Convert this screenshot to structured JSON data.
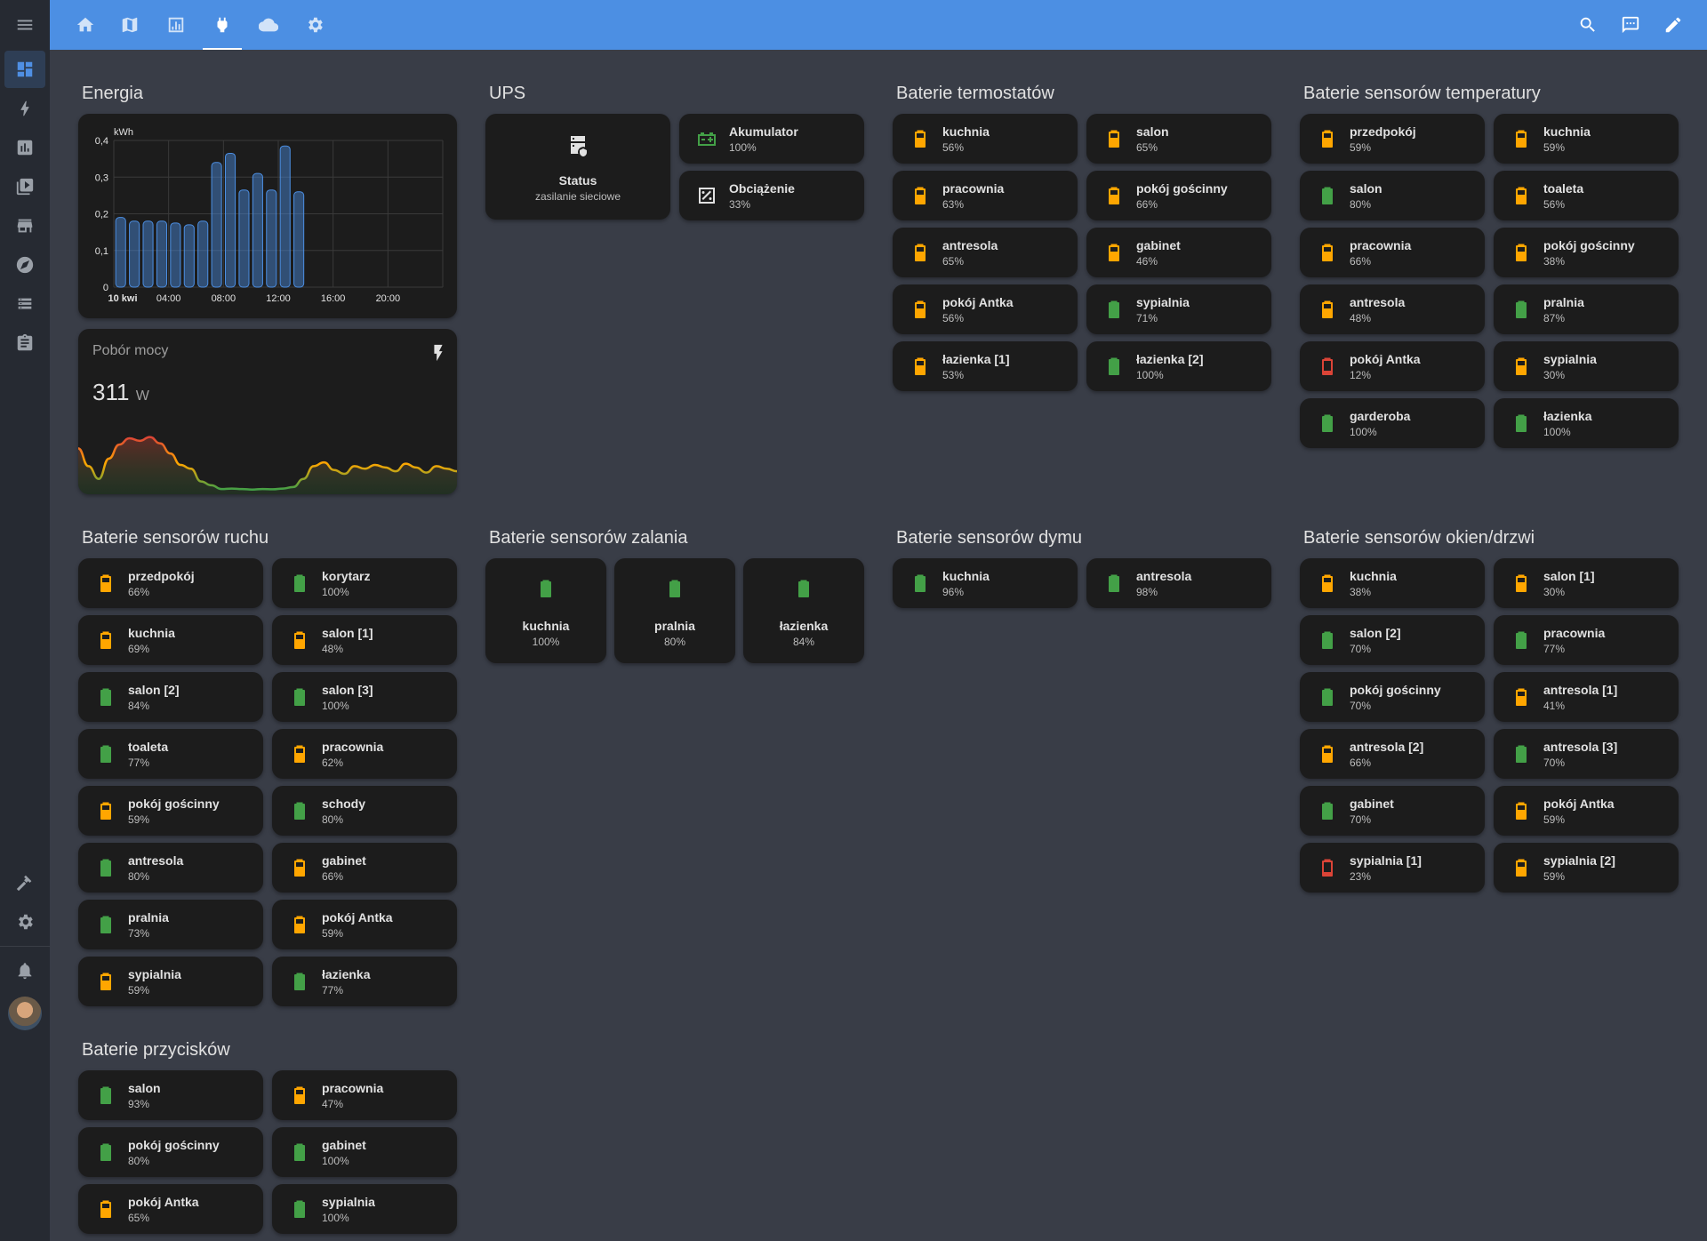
{
  "colors": {
    "header": "#4c8fe3",
    "green": "#43a047",
    "orange": "#ffa600",
    "red": "#db4437"
  },
  "header": {
    "tabs": [
      "home-icon",
      "map-icon",
      "chart-icon",
      "plug-icon",
      "cloud-icon",
      "gear-icon"
    ],
    "active_tab": "plug-icon",
    "actions": [
      "search-icon",
      "assist-icon",
      "pencil-icon"
    ]
  },
  "sidebar": {
    "items": [
      "menu-icon",
      "dashboard-icon",
      "energy-icon",
      "history-icon",
      "media-icon",
      "store-icon",
      "compass-icon",
      "devices-icon",
      "clipboard-icon"
    ],
    "bottom": [
      "hammer-icon",
      "settings-icon",
      "bell-icon",
      "avatar"
    ]
  },
  "energy": {
    "title": "Energia",
    "chart_data": {
      "type": "bar",
      "ylabel": "kWh",
      "ylim": [
        0,
        0.4
      ],
      "yticks": [
        "0",
        "0,1",
        "0,2",
        "0,3",
        "0,4"
      ],
      "xticks": [
        "10 kwi",
        "04:00",
        "08:00",
        "12:00",
        "16:00",
        "20:00"
      ],
      "categories": [
        "00:00",
        "01:00",
        "02:00",
        "03:00",
        "04:00",
        "05:00",
        "06:00",
        "07:00",
        "08:00",
        "09:00",
        "10:00",
        "11:00",
        "12:00",
        "13:00"
      ],
      "values": [
        0.19,
        0.18,
        0.18,
        0.18,
        0.175,
        0.17,
        0.18,
        0.34,
        0.365,
        0.265,
        0.31,
        0.265,
        0.385,
        0.26
      ]
    }
  },
  "power": {
    "title": "Pobór mocy",
    "value": "311",
    "unit": "W",
    "icon": "flash-icon",
    "chart_data": {
      "type": "line",
      "values": [
        110,
        180,
        230,
        150,
        95,
        70,
        80,
        65,
        90,
        130,
        175,
        190,
        240,
        255,
        270,
        268,
        270,
        272,
        270,
        271,
        268,
        262,
        230,
        180,
        165,
        195,
        210,
        180,
        190,
        175,
        185,
        200,
        170,
        185,
        205,
        180,
        190,
        200
      ]
    }
  },
  "ups": {
    "title": "UPS",
    "status": {
      "name": "Status",
      "value": "zasilanie sieciowe",
      "icon": "server-icon"
    },
    "items": [
      {
        "name": "Akumulator",
        "value": "100%",
        "icon": "battery-charging-icon"
      },
      {
        "name": "Obciążenie",
        "value": "33%",
        "icon": "percent-box-icon"
      }
    ]
  },
  "thermostats": {
    "title": "Baterie termostatów",
    "items": [
      {
        "name": "kuchnia",
        "value": "56%",
        "level": "orange"
      },
      {
        "name": "salon",
        "value": "65%",
        "level": "orange"
      },
      {
        "name": "pracownia",
        "value": "63%",
        "level": "orange"
      },
      {
        "name": "pokój gościnny",
        "value": "66%",
        "level": "orange"
      },
      {
        "name": "antresola",
        "value": "65%",
        "level": "orange"
      },
      {
        "name": "gabinet",
        "value": "46%",
        "level": "orange"
      },
      {
        "name": "pokój Antka",
        "value": "56%",
        "level": "orange"
      },
      {
        "name": "sypialnia",
        "value": "71%",
        "level": "green"
      },
      {
        "name": "łazienka [1]",
        "value": "53%",
        "level": "orange"
      },
      {
        "name": "łazienka [2]",
        "value": "100%",
        "level": "green"
      }
    ]
  },
  "temperature": {
    "title": "Baterie sensorów temperatury",
    "items": [
      {
        "name": "przedpokój",
        "value": "59%",
        "level": "orange"
      },
      {
        "name": "kuchnia",
        "value": "59%",
        "level": "orange"
      },
      {
        "name": "salon",
        "value": "80%",
        "level": "green"
      },
      {
        "name": "toaleta",
        "value": "56%",
        "level": "orange"
      },
      {
        "name": "pracownia",
        "value": "66%",
        "level": "orange"
      },
      {
        "name": "pokój gościnny",
        "value": "38%",
        "level": "orange"
      },
      {
        "name": "antresola",
        "value": "48%",
        "level": "orange"
      },
      {
        "name": "pralnia",
        "value": "87%",
        "level": "green"
      },
      {
        "name": "pokój Antka",
        "value": "12%",
        "level": "red"
      },
      {
        "name": "sypialnia",
        "value": "30%",
        "level": "orange"
      },
      {
        "name": "garderoba",
        "value": "100%",
        "level": "green"
      },
      {
        "name": "łazienka",
        "value": "100%",
        "level": "green"
      }
    ]
  },
  "motion": {
    "title": "Baterie sensorów ruchu",
    "items": [
      {
        "name": "przedpokój",
        "value": "66%",
        "level": "orange"
      },
      {
        "name": "korytarz",
        "value": "100%",
        "level": "green"
      },
      {
        "name": "kuchnia",
        "value": "69%",
        "level": "orange"
      },
      {
        "name": "salon [1]",
        "value": "48%",
        "level": "orange"
      },
      {
        "name": "salon [2]",
        "value": "84%",
        "level": "green"
      },
      {
        "name": "salon [3]",
        "value": "100%",
        "level": "green"
      },
      {
        "name": "toaleta",
        "value": "77%",
        "level": "green"
      },
      {
        "name": "pracownia",
        "value": "62%",
        "level": "orange"
      },
      {
        "name": "pokój gościnny",
        "value": "59%",
        "level": "orange"
      },
      {
        "name": "schody",
        "value": "80%",
        "level": "green"
      },
      {
        "name": "antresola",
        "value": "80%",
        "level": "green"
      },
      {
        "name": "gabinet",
        "value": "66%",
        "level": "orange"
      },
      {
        "name": "pralnia",
        "value": "73%",
        "level": "green"
      },
      {
        "name": "pokój Antka",
        "value": "59%",
        "level": "orange"
      },
      {
        "name": "sypialnia",
        "value": "59%",
        "level": "orange"
      },
      {
        "name": "łazienka",
        "value": "77%",
        "level": "green"
      }
    ]
  },
  "flood": {
    "title": "Baterie sensorów zalania",
    "items": [
      {
        "name": "kuchnia",
        "value": "100%",
        "level": "green"
      },
      {
        "name": "pralnia",
        "value": "80%",
        "level": "green"
      },
      {
        "name": "łazienka",
        "value": "84%",
        "level": "green"
      }
    ]
  },
  "smoke": {
    "title": "Baterie sensorów dymu",
    "items": [
      {
        "name": "kuchnia",
        "value": "96%",
        "level": "green"
      },
      {
        "name": "antresola",
        "value": "98%",
        "level": "green"
      }
    ]
  },
  "windows": {
    "title": "Baterie sensorów okien/drzwi",
    "items": [
      {
        "name": "kuchnia",
        "value": "38%",
        "level": "orange"
      },
      {
        "name": "salon [1]",
        "value": "30%",
        "level": "orange"
      },
      {
        "name": "salon [2]",
        "value": "70%",
        "level": "green"
      },
      {
        "name": "pracownia",
        "value": "77%",
        "level": "green"
      },
      {
        "name": "pokój gościnny",
        "value": "70%",
        "level": "green"
      },
      {
        "name": "antresola [1]",
        "value": "41%",
        "level": "orange"
      },
      {
        "name": "antresola [2]",
        "value": "66%",
        "level": "orange"
      },
      {
        "name": "antresola [3]",
        "value": "70%",
        "level": "green"
      },
      {
        "name": "gabinet",
        "value": "70%",
        "level": "green"
      },
      {
        "name": "pokój Antka",
        "value": "59%",
        "level": "orange"
      },
      {
        "name": "sypialnia [1]",
        "value": "23%",
        "level": "red"
      },
      {
        "name": "sypialnia [2]",
        "value": "59%",
        "level": "orange"
      }
    ]
  },
  "buttons": {
    "title": "Baterie przycisków",
    "items": [
      {
        "name": "salon",
        "value": "93%",
        "level": "green"
      },
      {
        "name": "pracownia",
        "value": "47%",
        "level": "orange"
      },
      {
        "name": "pokój gościnny",
        "value": "80%",
        "level": "green"
      },
      {
        "name": "gabinet",
        "value": "100%",
        "level": "green"
      },
      {
        "name": "pokój Antka",
        "value": "65%",
        "level": "orange"
      },
      {
        "name": "sypialnia",
        "value": "100%",
        "level": "green"
      }
    ]
  }
}
